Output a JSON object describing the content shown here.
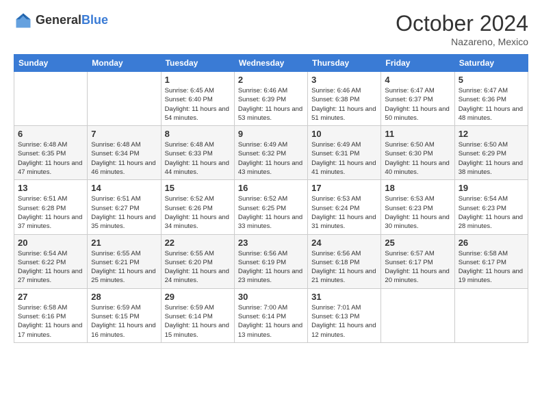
{
  "header": {
    "logo_general": "General",
    "logo_blue": "Blue",
    "month_title": "October 2024",
    "location": "Nazareno, Mexico"
  },
  "weekdays": [
    "Sunday",
    "Monday",
    "Tuesday",
    "Wednesday",
    "Thursday",
    "Friday",
    "Saturday"
  ],
  "weeks": [
    [
      {
        "day": "",
        "sunrise": "",
        "sunset": "",
        "daylight": ""
      },
      {
        "day": "",
        "sunrise": "",
        "sunset": "",
        "daylight": ""
      },
      {
        "day": "1",
        "sunrise": "Sunrise: 6:45 AM",
        "sunset": "Sunset: 6:40 PM",
        "daylight": "Daylight: 11 hours and 54 minutes."
      },
      {
        "day": "2",
        "sunrise": "Sunrise: 6:46 AM",
        "sunset": "Sunset: 6:39 PM",
        "daylight": "Daylight: 11 hours and 53 minutes."
      },
      {
        "day": "3",
        "sunrise": "Sunrise: 6:46 AM",
        "sunset": "Sunset: 6:38 PM",
        "daylight": "Daylight: 11 hours and 51 minutes."
      },
      {
        "day": "4",
        "sunrise": "Sunrise: 6:47 AM",
        "sunset": "Sunset: 6:37 PM",
        "daylight": "Daylight: 11 hours and 50 minutes."
      },
      {
        "day": "5",
        "sunrise": "Sunrise: 6:47 AM",
        "sunset": "Sunset: 6:36 PM",
        "daylight": "Daylight: 11 hours and 48 minutes."
      }
    ],
    [
      {
        "day": "6",
        "sunrise": "Sunrise: 6:48 AM",
        "sunset": "Sunset: 6:35 PM",
        "daylight": "Daylight: 11 hours and 47 minutes."
      },
      {
        "day": "7",
        "sunrise": "Sunrise: 6:48 AM",
        "sunset": "Sunset: 6:34 PM",
        "daylight": "Daylight: 11 hours and 46 minutes."
      },
      {
        "day": "8",
        "sunrise": "Sunrise: 6:48 AM",
        "sunset": "Sunset: 6:33 PM",
        "daylight": "Daylight: 11 hours and 44 minutes."
      },
      {
        "day": "9",
        "sunrise": "Sunrise: 6:49 AM",
        "sunset": "Sunset: 6:32 PM",
        "daylight": "Daylight: 11 hours and 43 minutes."
      },
      {
        "day": "10",
        "sunrise": "Sunrise: 6:49 AM",
        "sunset": "Sunset: 6:31 PM",
        "daylight": "Daylight: 11 hours and 41 minutes."
      },
      {
        "day": "11",
        "sunrise": "Sunrise: 6:50 AM",
        "sunset": "Sunset: 6:30 PM",
        "daylight": "Daylight: 11 hours and 40 minutes."
      },
      {
        "day": "12",
        "sunrise": "Sunrise: 6:50 AM",
        "sunset": "Sunset: 6:29 PM",
        "daylight": "Daylight: 11 hours and 38 minutes."
      }
    ],
    [
      {
        "day": "13",
        "sunrise": "Sunrise: 6:51 AM",
        "sunset": "Sunset: 6:28 PM",
        "daylight": "Daylight: 11 hours and 37 minutes."
      },
      {
        "day": "14",
        "sunrise": "Sunrise: 6:51 AM",
        "sunset": "Sunset: 6:27 PM",
        "daylight": "Daylight: 11 hours and 35 minutes."
      },
      {
        "day": "15",
        "sunrise": "Sunrise: 6:52 AM",
        "sunset": "Sunset: 6:26 PM",
        "daylight": "Daylight: 11 hours and 34 minutes."
      },
      {
        "day": "16",
        "sunrise": "Sunrise: 6:52 AM",
        "sunset": "Sunset: 6:25 PM",
        "daylight": "Daylight: 11 hours and 33 minutes."
      },
      {
        "day": "17",
        "sunrise": "Sunrise: 6:53 AM",
        "sunset": "Sunset: 6:24 PM",
        "daylight": "Daylight: 11 hours and 31 minutes."
      },
      {
        "day": "18",
        "sunrise": "Sunrise: 6:53 AM",
        "sunset": "Sunset: 6:23 PM",
        "daylight": "Daylight: 11 hours and 30 minutes."
      },
      {
        "day": "19",
        "sunrise": "Sunrise: 6:54 AM",
        "sunset": "Sunset: 6:23 PM",
        "daylight": "Daylight: 11 hours and 28 minutes."
      }
    ],
    [
      {
        "day": "20",
        "sunrise": "Sunrise: 6:54 AM",
        "sunset": "Sunset: 6:22 PM",
        "daylight": "Daylight: 11 hours and 27 minutes."
      },
      {
        "day": "21",
        "sunrise": "Sunrise: 6:55 AM",
        "sunset": "Sunset: 6:21 PM",
        "daylight": "Daylight: 11 hours and 25 minutes."
      },
      {
        "day": "22",
        "sunrise": "Sunrise: 6:55 AM",
        "sunset": "Sunset: 6:20 PM",
        "daylight": "Daylight: 11 hours and 24 minutes."
      },
      {
        "day": "23",
        "sunrise": "Sunrise: 6:56 AM",
        "sunset": "Sunset: 6:19 PM",
        "daylight": "Daylight: 11 hours and 23 minutes."
      },
      {
        "day": "24",
        "sunrise": "Sunrise: 6:56 AM",
        "sunset": "Sunset: 6:18 PM",
        "daylight": "Daylight: 11 hours and 21 minutes."
      },
      {
        "day": "25",
        "sunrise": "Sunrise: 6:57 AM",
        "sunset": "Sunset: 6:17 PM",
        "daylight": "Daylight: 11 hours and 20 minutes."
      },
      {
        "day": "26",
        "sunrise": "Sunrise: 6:58 AM",
        "sunset": "Sunset: 6:17 PM",
        "daylight": "Daylight: 11 hours and 19 minutes."
      }
    ],
    [
      {
        "day": "27",
        "sunrise": "Sunrise: 6:58 AM",
        "sunset": "Sunset: 6:16 PM",
        "daylight": "Daylight: 11 hours and 17 minutes."
      },
      {
        "day": "28",
        "sunrise": "Sunrise: 6:59 AM",
        "sunset": "Sunset: 6:15 PM",
        "daylight": "Daylight: 11 hours and 16 minutes."
      },
      {
        "day": "29",
        "sunrise": "Sunrise: 6:59 AM",
        "sunset": "Sunset: 6:14 PM",
        "daylight": "Daylight: 11 hours and 15 minutes."
      },
      {
        "day": "30",
        "sunrise": "Sunrise: 7:00 AM",
        "sunset": "Sunset: 6:14 PM",
        "daylight": "Daylight: 11 hours and 13 minutes."
      },
      {
        "day": "31",
        "sunrise": "Sunrise: 7:01 AM",
        "sunset": "Sunset: 6:13 PM",
        "daylight": "Daylight: 11 hours and 12 minutes."
      },
      {
        "day": "",
        "sunrise": "",
        "sunset": "",
        "daylight": ""
      },
      {
        "day": "",
        "sunrise": "",
        "sunset": "",
        "daylight": ""
      }
    ]
  ]
}
